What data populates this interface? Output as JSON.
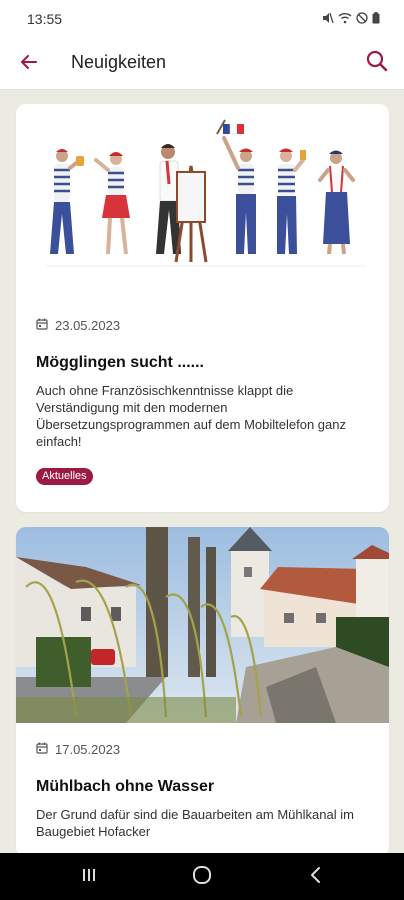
{
  "status": {
    "time": "13:55"
  },
  "appbar": {
    "title": "Neuigkeiten"
  },
  "colors": {
    "accent": "#9b1b42",
    "background": "#ecebe2"
  },
  "icons": {
    "back": "arrow-back-icon",
    "search": "search-icon",
    "date": "calendar-icon"
  },
  "news": [
    {
      "date": "23.05.2023",
      "title": "Mögglingen sucht ......",
      "text": "Auch ohne Französischkenntnisse klappt die Verständigung mit den modernen Übersetzungsprogrammen auf dem Mobiltelefon ganz einfach!",
      "tag": "Aktuelles"
    },
    {
      "date": "17.05.2023",
      "title": "Mühlbach ohne Wasser",
      "text": "Der Grund dafür sind die Bauarbeiten am Mühlkanal im Baugebiet Hofacker"
    }
  ]
}
